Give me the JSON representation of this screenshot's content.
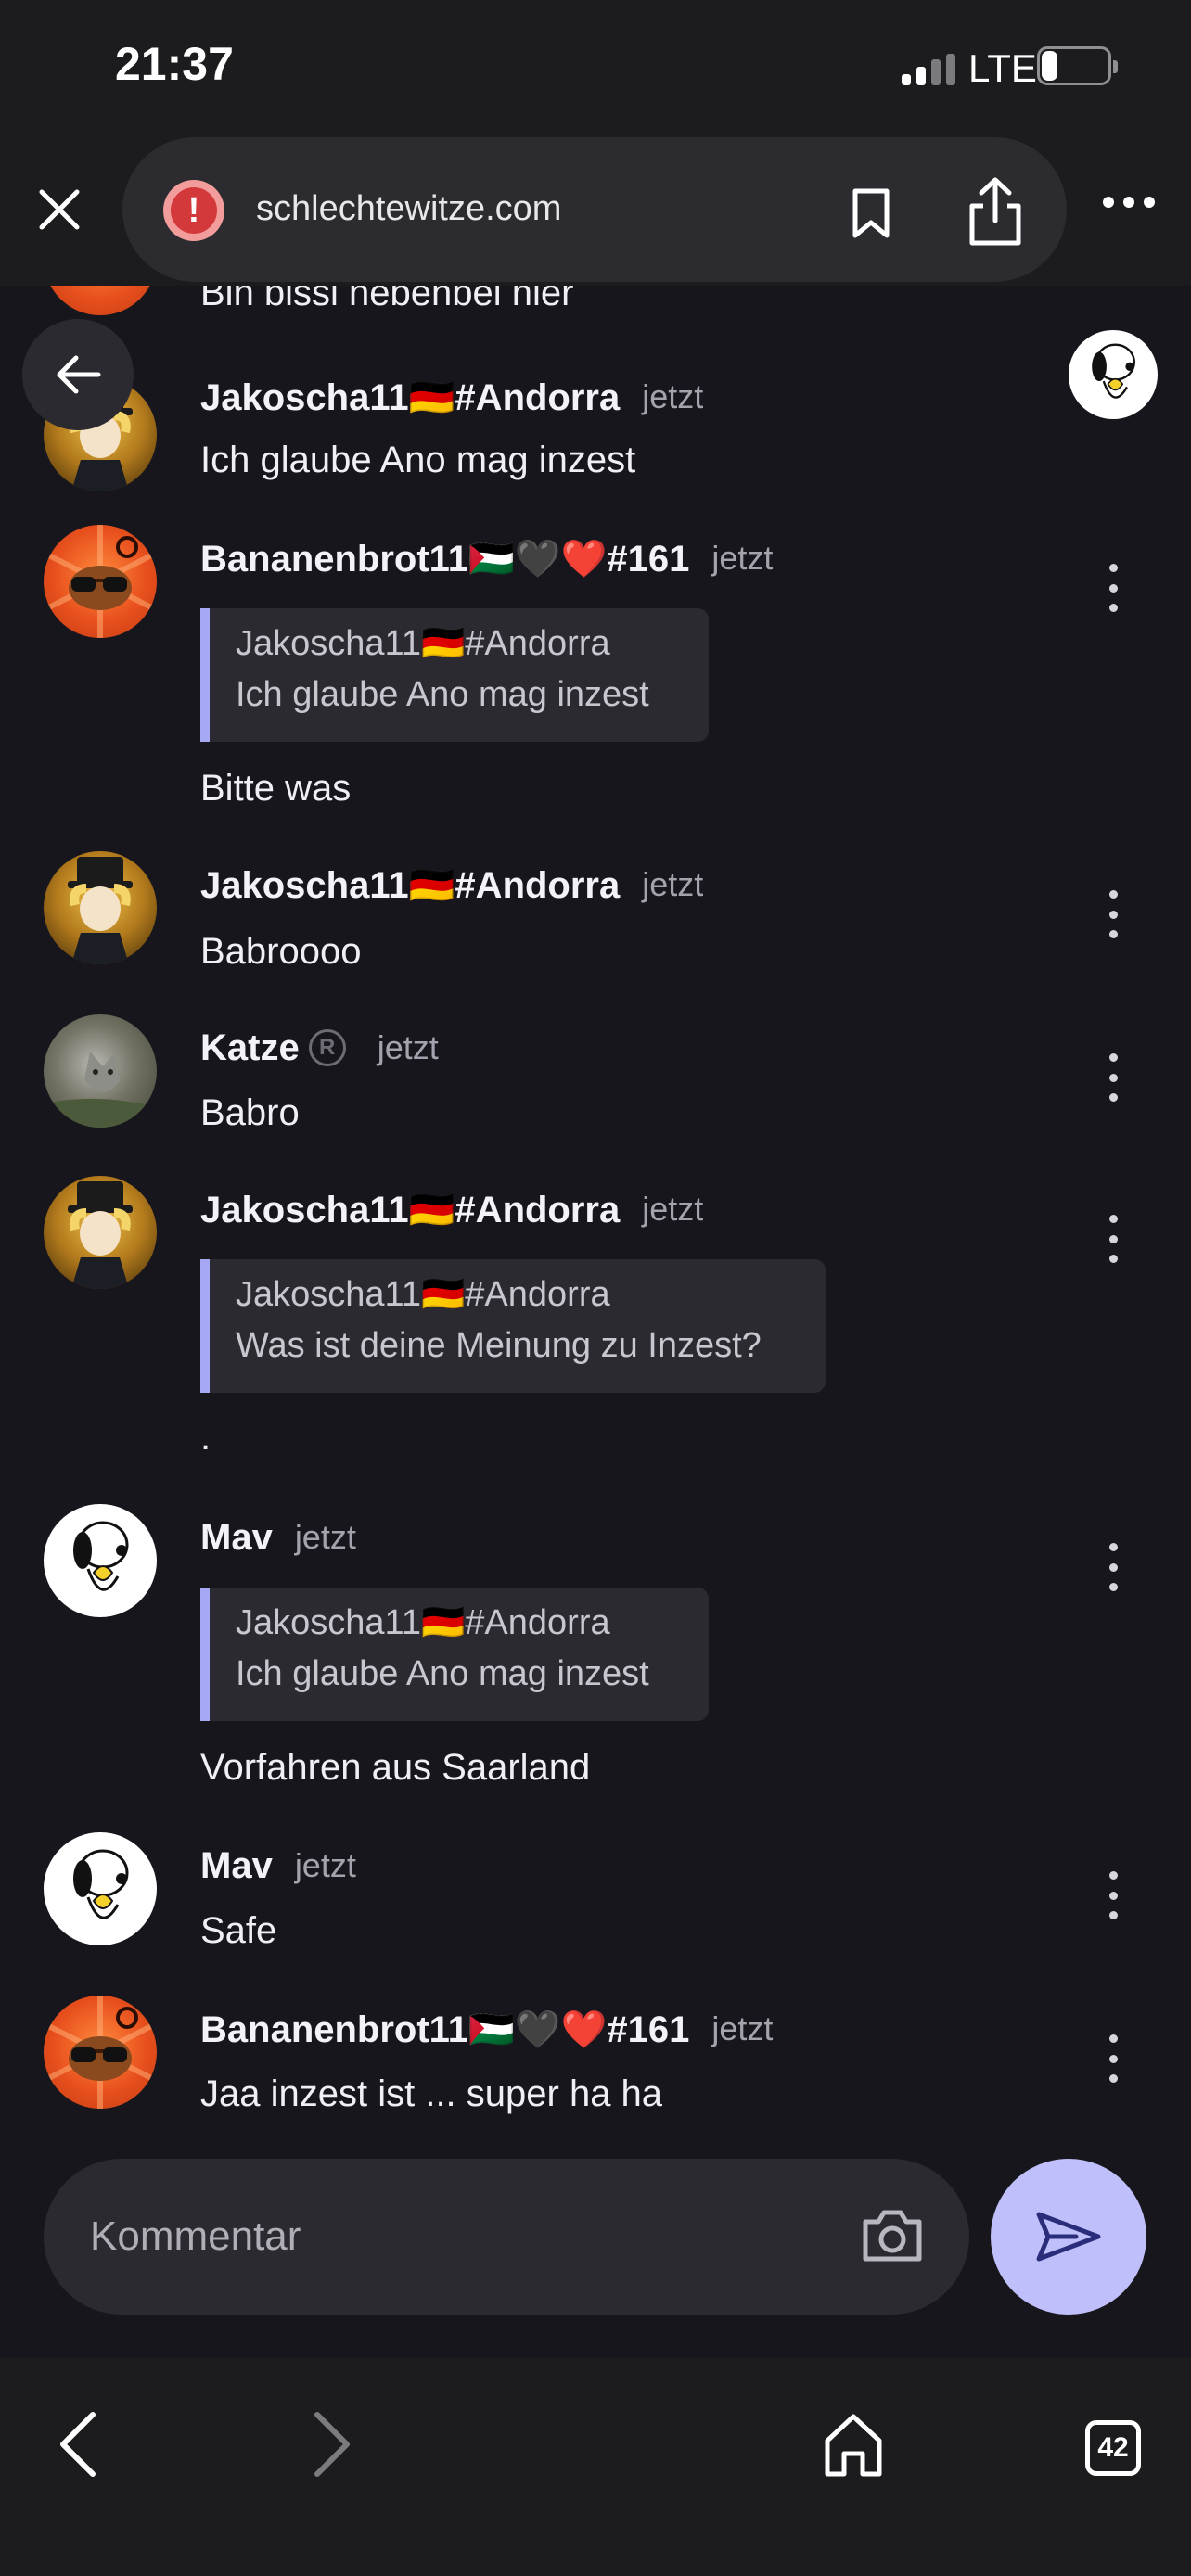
{
  "status_bar": {
    "time": "21:37",
    "network": "LTE",
    "battery": "24",
    "battery_level": 0.24
  },
  "browser": {
    "url": "schlechtewitze.com",
    "tab_count": "42"
  },
  "messages": [
    {
      "text": "Bin bissi nebenbei hier"
    },
    {
      "author": "Jakoscha11🇩🇪#Andorra",
      "time": "jetzt",
      "text": "Ich glaube Ano mag inzest"
    },
    {
      "author": "Bananenbrot11🇵🇸🖤❤️#161",
      "time": "jetzt",
      "quote": {
        "author": "Jakoscha11🇩🇪#Andorra",
        "text": "Ich glaube Ano mag inzest"
      },
      "text": "Bitte was"
    },
    {
      "author": "Jakoscha11🇩🇪#Andorra",
      "time": "jetzt",
      "text": "Babroooo"
    },
    {
      "author": "Katze",
      "time": "jetzt",
      "badge": "R",
      "text": "Babro"
    },
    {
      "author": "Jakoscha11🇩🇪#Andorra",
      "time": "jetzt",
      "quote": {
        "author": "Jakoscha11🇩🇪#Andorra",
        "text": "Was ist deine Meinung zu Inzest?"
      },
      "text": "."
    },
    {
      "author": "Mav",
      "time": "jetzt",
      "quote": {
        "author": "Jakoscha11🇩🇪#Andorra",
        "text": "Ich glaube Ano mag inzest"
      },
      "text": "Vorfahren aus Saarland"
    },
    {
      "author": "Mav",
      "time": "jetzt",
      "text": "Safe"
    },
    {
      "author": "Bananenbrot11🇵🇸🖤❤️#161",
      "time": "jetzt",
      "text": "Jaa inzest ist ... super ha ha"
    }
  ],
  "composer": {
    "placeholder": "Kommentar"
  },
  "colors": {
    "background": "#17161c",
    "quote_accent": "#a6a8f4",
    "send_button": "#bfc0fb",
    "bubble": "#2b2a31"
  }
}
